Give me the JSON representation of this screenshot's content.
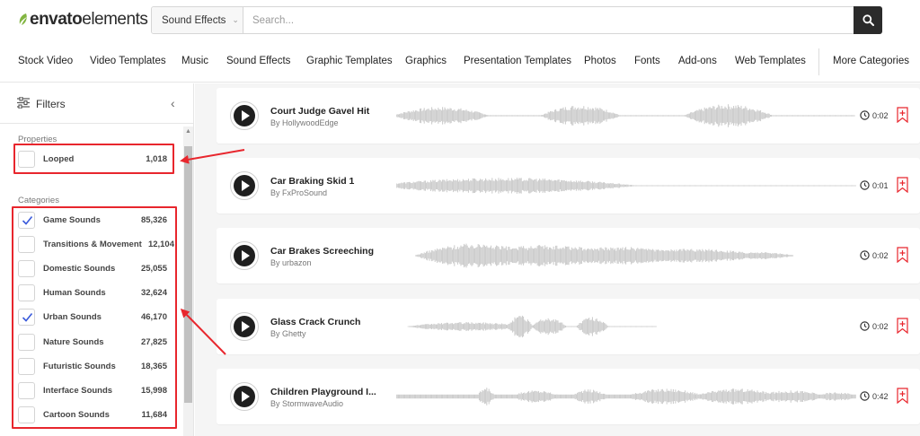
{
  "app": {
    "brand": "envato",
    "brand_suffix": "elements"
  },
  "search": {
    "category": "Sound Effects",
    "placeholder": "Search...",
    "value": ""
  },
  "nav": {
    "items": [
      {
        "label": "Stock Video"
      },
      {
        "label": "Video Templates"
      },
      {
        "label": "Music"
      },
      {
        "label": "Sound Effects"
      },
      {
        "label": "Graphic Templates"
      },
      {
        "label": "Graphics"
      },
      {
        "label": "Presentation Templates"
      },
      {
        "label": "Photos"
      },
      {
        "label": "Fonts"
      },
      {
        "label": "Add-ons"
      },
      {
        "label": "Web Templates"
      }
    ],
    "more_label": "More Categories"
  },
  "sidebar": {
    "title": "Filters",
    "properties_label": "Properties",
    "properties": [
      {
        "label": "Looped",
        "count": "1,018",
        "checked": false
      }
    ],
    "categories_label": "Categories",
    "categories": [
      {
        "label": "Game Sounds",
        "count": "85,326",
        "checked": true
      },
      {
        "label": "Transitions & Movement",
        "count": "12,104",
        "checked": false
      },
      {
        "label": "Domestic Sounds",
        "count": "25,055",
        "checked": false
      },
      {
        "label": "Human Sounds",
        "count": "32,624",
        "checked": false
      },
      {
        "label": "Urban Sounds",
        "count": "46,170",
        "checked": true
      },
      {
        "label": "Nature Sounds",
        "count": "27,825",
        "checked": false
      },
      {
        "label": "Futuristic Sounds",
        "count": "18,365",
        "checked": false
      },
      {
        "label": "Interface Sounds",
        "count": "15,998",
        "checked": false
      },
      {
        "label": "Cartoon Sounds",
        "count": "11,684",
        "checked": false
      }
    ]
  },
  "tracks": [
    {
      "title": "Court Judge Gavel Hit",
      "author": "By HollywoodEdge",
      "duration": "0:02"
    },
    {
      "title": "Car Braking Skid 1",
      "author": "By FxProSound",
      "duration": "0:01"
    },
    {
      "title": "Car Brakes Screeching",
      "author": "By urbazon",
      "duration": "0:02"
    },
    {
      "title": "Glass Crack Crunch",
      "author": "By Ghetty",
      "duration": "0:02"
    },
    {
      "title": "Children Playground I...",
      "author": "By StormwaveAudio",
      "duration": "0:42"
    }
  ],
  "colors": {
    "accent_red": "#e8262d",
    "check_blue": "#3b5bdb",
    "waveform": "#c9c9c9",
    "dark": "#2b2b2b",
    "brand_green": "#82b541"
  },
  "icons": {
    "search": "magnifier-icon",
    "filters": "sliders-icon",
    "collapse": "chevron-left-icon",
    "play": "play-icon",
    "clock": "clock-icon",
    "bookmark": "bookmark-plus-icon"
  }
}
